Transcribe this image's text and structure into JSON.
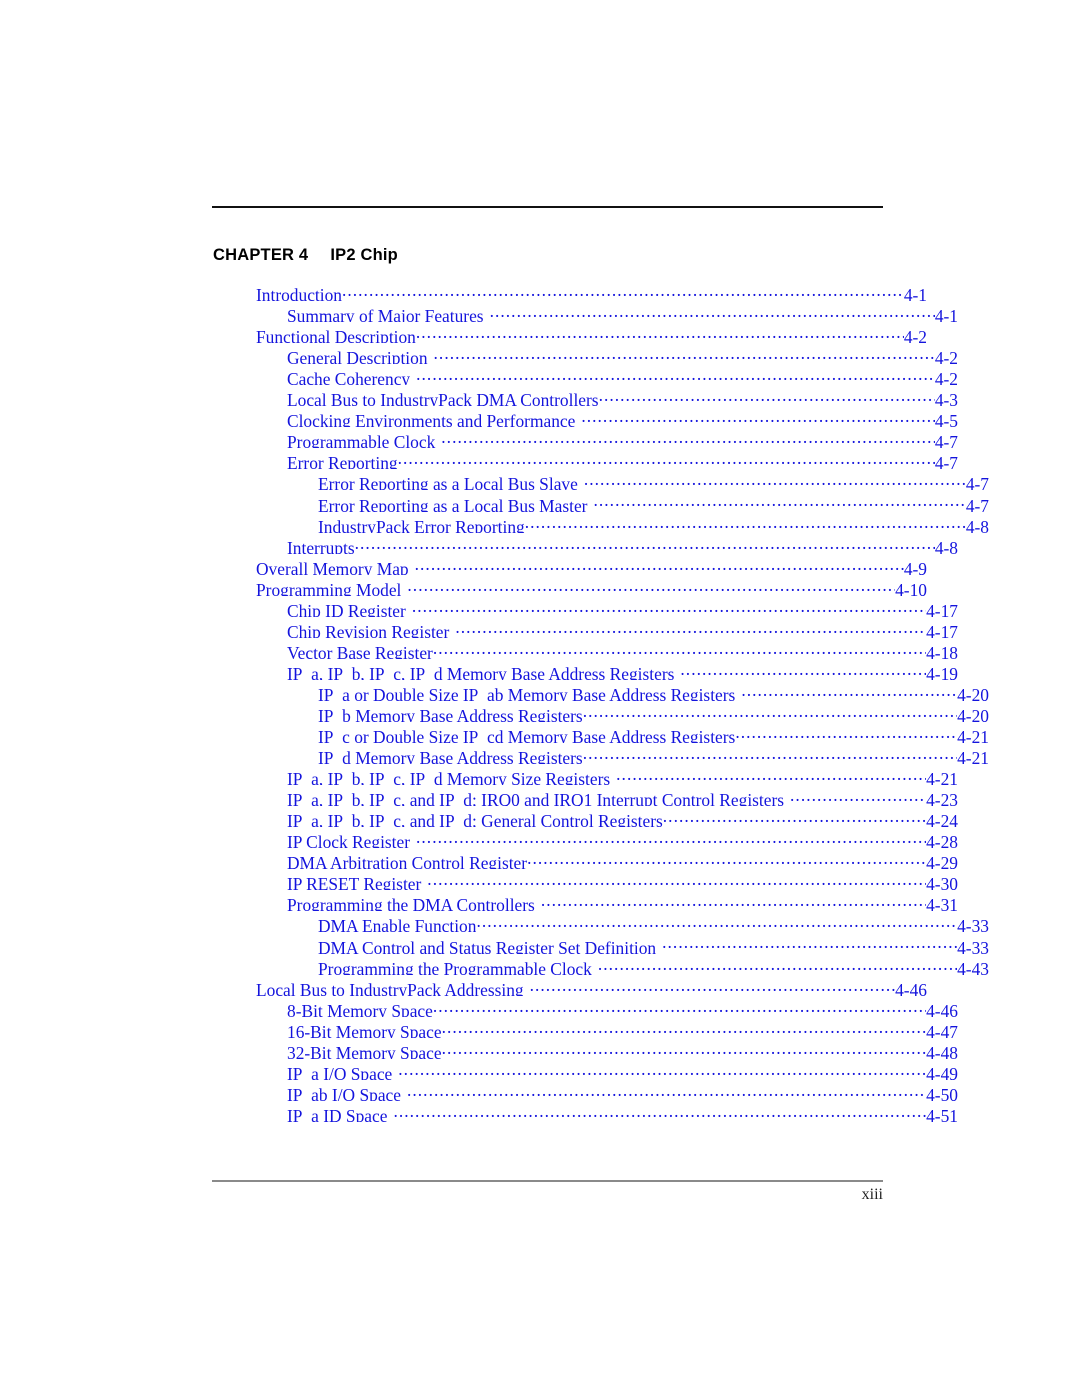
{
  "document": {
    "page_number": "xiii"
  },
  "chapter": {
    "label": "CHAPTER 4",
    "title": "IP2 Chip"
  },
  "toc": {
    "entries": [
      {
        "title": "Introduction",
        "page": "4-1",
        "level": 1,
        "gap": false
      },
      {
        "title": "Summary of Major Features",
        "page": "4-1",
        "level": 2,
        "gap": true
      },
      {
        "title": "Functional Description",
        "page": "4-2",
        "level": 1,
        "gap": false
      },
      {
        "title": "General Description",
        "page": "4-2",
        "level": 2,
        "gap": true
      },
      {
        "title": "Cache Coherency",
        "page": "4-2",
        "level": 2,
        "gap": true
      },
      {
        "title": "Local Bus to IndustryPack DMA Controllers",
        "page": "4-3",
        "level": 2,
        "gap": false
      },
      {
        "title": "Clocking Environments and Performance",
        "page": "4-5",
        "level": 2,
        "gap": true
      },
      {
        "title": "Programmable Clock",
        "page": "4-7",
        "level": 2,
        "gap": true
      },
      {
        "title": "Error Reporting",
        "page": "4-7",
        "level": 2,
        "gap": false
      },
      {
        "title": "Error Reporting as a Local Bus Slave",
        "page": "4-7",
        "level": 3,
        "gap": true
      },
      {
        "title": "Error Reporting as a Local Bus Master",
        "page": "4-7",
        "level": 3,
        "gap": true
      },
      {
        "title": "IndustryPack Error Reporting",
        "page": "4-8",
        "level": 3,
        "gap": false
      },
      {
        "title": "Interrupts",
        "page": "4-8",
        "level": 2,
        "gap": false
      },
      {
        "title": "Overall Memory Map",
        "page": "4-9",
        "level": 1,
        "gap": true
      },
      {
        "title": "Programming Model",
        "page": "4-10",
        "level": 1,
        "gap": true
      },
      {
        "title": "Chip ID Register",
        "page": "4-17",
        "level": 2,
        "gap": true
      },
      {
        "title": "Chip Revision Register",
        "page": "4-17",
        "level": 2,
        "gap": true
      },
      {
        "title": "Vector Base Register",
        "page": "4-18",
        "level": 2,
        "gap": false
      },
      {
        "title": "IP_a, IP_b, IP_c, IP_d Memory Base Address Registers",
        "page": "4-19",
        "level": 2,
        "gap": true
      },
      {
        "title": "IP_a or Double Size IP_ab Memory Base Address Registers",
        "page": "4-20",
        "level": 3,
        "gap": true
      },
      {
        "title": "IP_b Memory Base Address Registers",
        "page": "4-20",
        "level": 3,
        "gap": false
      },
      {
        "title": "IP_c or Double Size IP_cd Memory Base Address Registers",
        "page": "4-21",
        "level": 3,
        "gap": false
      },
      {
        "title": "IP_d Memory Base Address Registers",
        "page": "4-21",
        "level": 3,
        "gap": false
      },
      {
        "title": "IP_a, IP_b, IP_c, IP_d Memory Size Registers",
        "page": "4-21",
        "level": 2,
        "gap": true
      },
      {
        "title": "IP_a, IP_b, IP_c, and IP_d; IRQ0 and IRQ1 Interrupt Control Registers",
        "page": "4-23",
        "level": 2,
        "gap": true
      },
      {
        "title": "IP_a, IP_b, IP_c, and IP_d; General Control Registers",
        "page": "4-24",
        "level": 2,
        "gap": false
      },
      {
        "title": "IP Clock Register",
        "page": "4-28",
        "level": 2,
        "gap": true
      },
      {
        "title": "DMA Arbitration Control Register",
        "page": "4-29",
        "level": 2,
        "gap": false
      },
      {
        "title": "IP RESET Register",
        "page": "4-30",
        "level": 2,
        "gap": true
      },
      {
        "title": "Programming the DMA Controllers",
        "page": "4-31",
        "level": 2,
        "gap": true
      },
      {
        "title": "DMA Enable Function",
        "page": "4-33",
        "level": 3,
        "gap": false
      },
      {
        "title": "DMA Control and Status Register Set Definition",
        "page": "4-33",
        "level": 3,
        "gap": true
      },
      {
        "title": "Programming the Programmable Clock",
        "page": "4-43",
        "level": 3,
        "gap": true
      },
      {
        "title": "Local Bus to IndustryPack Addressing",
        "page": "4-46",
        "level": 1,
        "gap": true
      },
      {
        "title": "8-Bit Memory Space",
        "page": "4-46",
        "level": 2,
        "gap": false
      },
      {
        "title": "16-Bit Memory Space",
        "page": "4-47",
        "level": 2,
        "gap": false
      },
      {
        "title": "32-Bit Memory Space",
        "page": "4-48",
        "level": 2,
        "gap": false
      },
      {
        "title": "IP_a I/O Space",
        "page": "4-49",
        "level": 2,
        "gap": true
      },
      {
        "title": "IP_ab I/O Space",
        "page": "4-50",
        "level": 2,
        "gap": true
      },
      {
        "title": "IP_a ID Space",
        "page": "4-51",
        "level": 2,
        "gap": true
      }
    ]
  },
  "colors": {
    "link_blue": "#1414dd",
    "rule_top": "#111111",
    "rule_bottom": "#8a8a8a"
  }
}
